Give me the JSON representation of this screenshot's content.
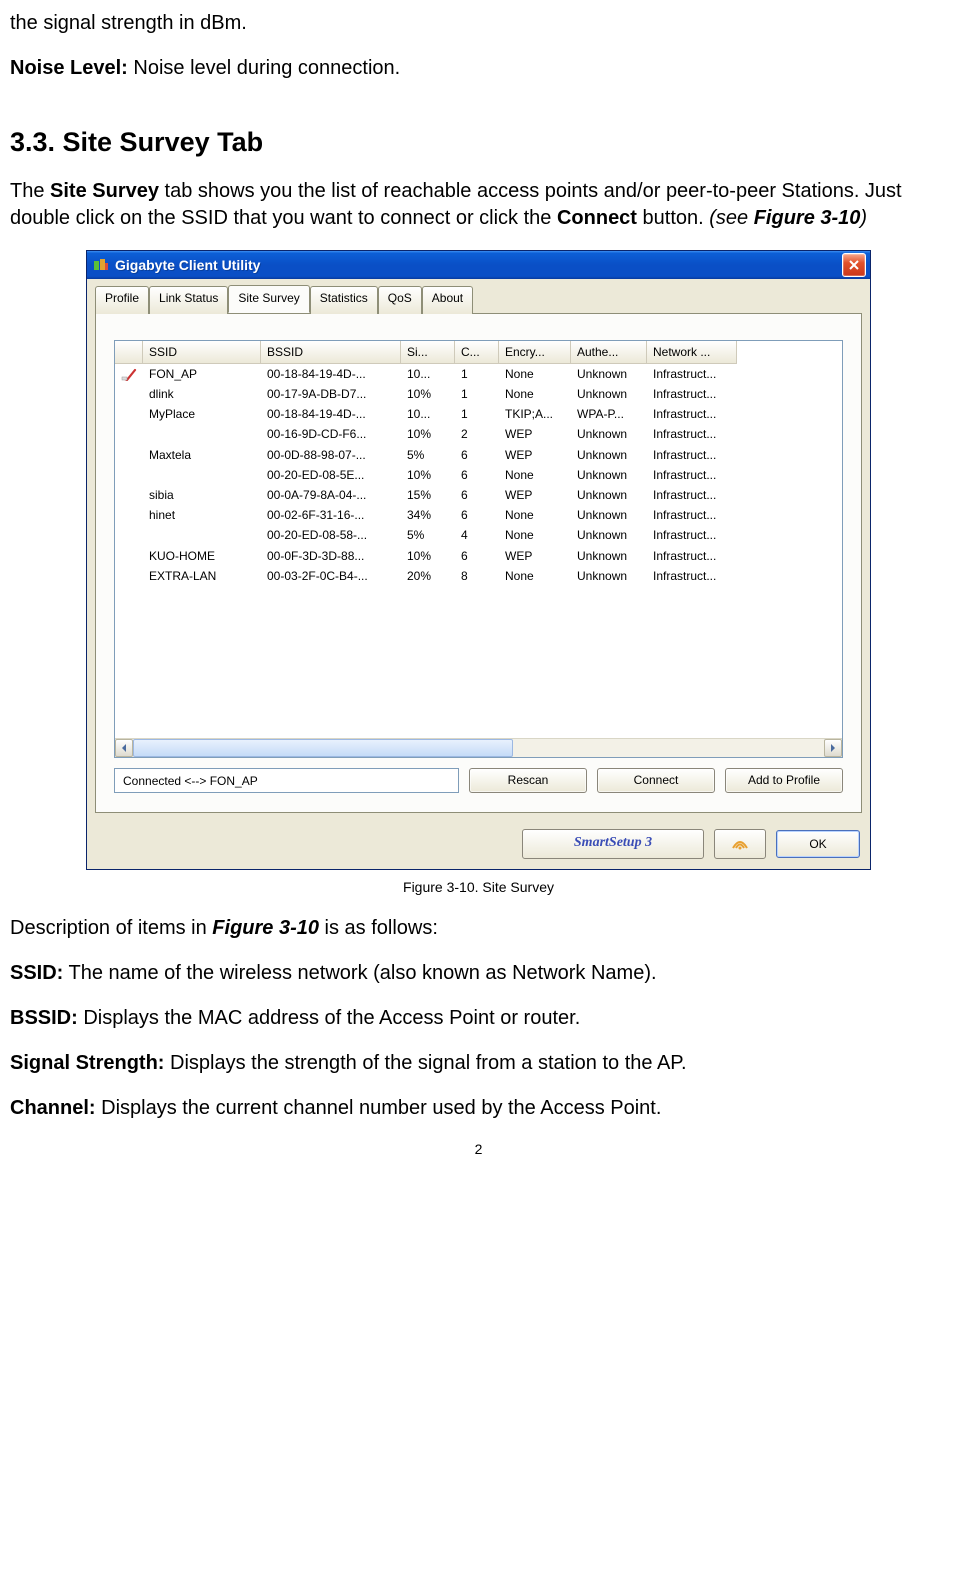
{
  "intro_lines": {
    "line1": "the signal strength in dBm.",
    "noise_prefix": "Noise Level:",
    "noise_desc": " Noise level during connection."
  },
  "section_heading": "3.3.  Site Survey Tab",
  "section_para": {
    "p_before_b1": "The ",
    "b1": "Site Survey",
    "p_mid1": " tab shows you the list of reachable access points and/or peer-to-peer Stations. Just double click on the SSID that you want to connect or click the ",
    "b2": "Connect",
    "p_mid2": " button. ",
    "i_open": "(see ",
    "bi": "Figure 3-10",
    "i_close": ")"
  },
  "window": {
    "title": "Gigabyte Client Utility",
    "tabs": [
      "Profile",
      "Link Status",
      "Site Survey",
      "Statistics",
      "QoS",
      "About"
    ],
    "active_tab_index": 2,
    "columns": [
      "",
      "SSID",
      "BSSID",
      "Si...",
      "C...",
      "Encry...",
      "Authe...",
      "Network ..."
    ],
    "rows": [
      {
        "connected": true,
        "ssid": "FON_AP",
        "bssid": "00-18-84-19-4D-...",
        "signal": "10...",
        "chan": "1",
        "enc": "None",
        "auth": "Unknown",
        "net": "Infrastruct..."
      },
      {
        "connected": false,
        "ssid": "dlink",
        "bssid": "00-17-9A-DB-D7...",
        "signal": "10%",
        "chan": "1",
        "enc": "None",
        "auth": "Unknown",
        "net": "Infrastruct..."
      },
      {
        "connected": false,
        "ssid": "MyPlace",
        "bssid": "00-18-84-19-4D-...",
        "signal": "10...",
        "chan": "1",
        "enc": "TKIP;A...",
        "auth": "WPA-P...",
        "net": "Infrastruct..."
      },
      {
        "connected": false,
        "ssid": "",
        "bssid": "00-16-9D-CD-F6...",
        "signal": "10%",
        "chan": "2",
        "enc": "WEP",
        "auth": "Unknown",
        "net": "Infrastruct..."
      },
      {
        "connected": false,
        "ssid": "Maxtela",
        "bssid": "00-0D-88-98-07-...",
        "signal": "5%",
        "chan": "6",
        "enc": "WEP",
        "auth": "Unknown",
        "net": "Infrastruct..."
      },
      {
        "connected": false,
        "ssid": "",
        "bssid": "00-20-ED-08-5E...",
        "signal": "10%",
        "chan": "6",
        "enc": "None",
        "auth": "Unknown",
        "net": "Infrastruct..."
      },
      {
        "connected": false,
        "ssid": "sibia",
        "bssid": "00-0A-79-8A-04-...",
        "signal": "15%",
        "chan": "6",
        "enc": "WEP",
        "auth": "Unknown",
        "net": "Infrastruct..."
      },
      {
        "connected": false,
        "ssid": "hinet",
        "bssid": "00-02-6F-31-16-...",
        "signal": "34%",
        "chan": "6",
        "enc": "None",
        "auth": "Unknown",
        "net": "Infrastruct..."
      },
      {
        "connected": false,
        "ssid": "",
        "bssid": "00-20-ED-08-58-...",
        "signal": "5%",
        "chan": "4",
        "enc": "None",
        "auth": "Unknown",
        "net": "Infrastruct..."
      },
      {
        "connected": false,
        "ssid": "KUO-HOME",
        "bssid": "00-0F-3D-3D-88...",
        "signal": "10%",
        "chan": "6",
        "enc": "WEP",
        "auth": "Unknown",
        "net": "Infrastruct..."
      },
      {
        "connected": false,
        "ssid": "EXTRA-LAN",
        "bssid": "00-03-2F-0C-B4-...",
        "signal": "20%",
        "chan": "8",
        "enc": "None",
        "auth": "Unknown",
        "net": "Infrastruct..."
      }
    ],
    "status_text": "Connected <--> FON_AP",
    "buttons": {
      "rescan": "Rescan",
      "connect": "Connect",
      "add_profile": "Add to Profile",
      "smart": "SmartSetup 3",
      "ok": "OK"
    }
  },
  "figure_caption": "Figure 3-10.    Site Survey",
  "desc_intro": {
    "before": "Description of items in ",
    "bi": "Figure 3-10",
    "after": " is as follows:"
  },
  "defs": {
    "ssid_l": "SSID:",
    "ssid_d": " The name of the wireless network (also known as Network Name).",
    "bssid_l": "BSSID:",
    "bssid_d": " Displays the MAC address of the Access Point or router.",
    "sig_l": "Signal Strength:",
    "sig_d": " Displays the strength of the signal from a station to the AP.",
    "chan_l": "Channel:",
    "chan_d": " Displays the current channel number used by the Access Point."
  },
  "page_number": "2"
}
